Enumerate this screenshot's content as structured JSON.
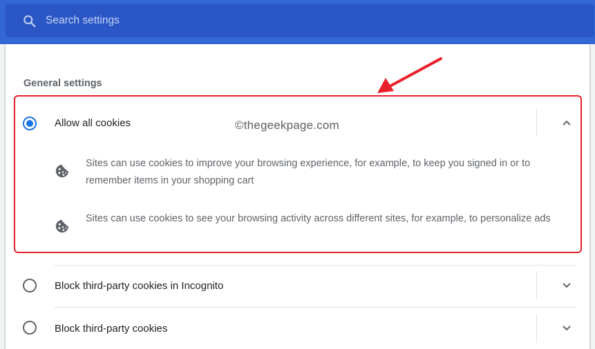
{
  "search": {
    "placeholder": "Search settings"
  },
  "section": {
    "title": "General settings"
  },
  "options": [
    {
      "label": "Allow all cookies",
      "selected": true,
      "expanded": true,
      "descriptions": [
        "Sites can use cookies to improve your browsing experience, for example, to keep you signed in or to remember items in your shopping cart",
        "Sites can use cookies to see your browsing activity across different sites, for example, to personalize ads"
      ]
    },
    {
      "label": "Block third-party cookies in Incognito",
      "selected": false,
      "expanded": false
    },
    {
      "label": "Block third-party cookies",
      "selected": false,
      "expanded": false
    }
  ],
  "watermark": "©thegeekpage.com",
  "icons": {
    "search": "search-icon",
    "expand": "chevron-up-icon",
    "collapse": "chevron-down-icon",
    "cookie": "cookie-icon"
  },
  "colors": {
    "header": "#3367d6",
    "search_box": "#2a56c6",
    "radio_selected": "#1a73e8",
    "annotation": "#e8202a"
  }
}
